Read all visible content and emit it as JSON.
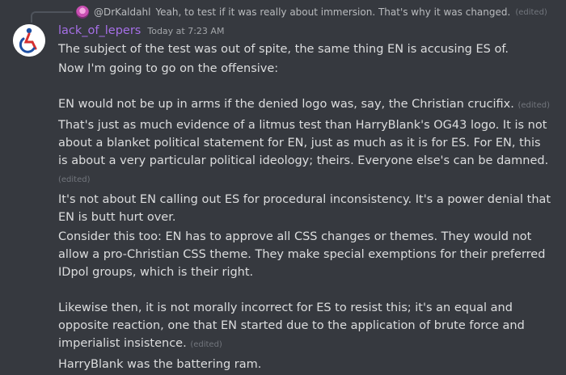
{
  "reply": {
    "author": "@DrKaldahl",
    "text": "Yeah, to test if it was really about immersion. That's why it was changed.",
    "edited": "(edited)"
  },
  "header": {
    "username": "lack_of_lepers",
    "timestamp": "Today at 7:23 AM"
  },
  "messages": [
    {
      "text": "The subject of the test was out of spite, the same thing EN is accusing ES of.",
      "edited": ""
    },
    {
      "text": "Now I'm going to go on the offensive:",
      "edited": ""
    },
    {
      "text": "EN would not be up in arms if the denied logo was, say, the Christian crucifix.",
      "edited": "(edited)"
    },
    {
      "text": "That's just as much evidence of a litmus test than HarryBlank's OG43 logo. It is not about a blanket political statement for EN, just as much as it is for ES. For EN, this is about a very particular political ideology; theirs. Everyone else's can be damned.",
      "edited": "(edited)"
    },
    {
      "text": "It's not about EN calling out ES for procedural inconsistency. It's a power denial that EN is butt hurt over.",
      "edited": ""
    },
    {
      "text": "Consider this too: EN has to approve all CSS changes or themes. They would not allow a pro-Christian CSS theme. They make special exemptions for their preferred IDpol groups, which is their right.",
      "edited": ""
    },
    {
      "text": "Likewise then, it is not morally incorrect for ES to resist this; it's an equal and opposite reaction, one that EN started due to the application of brute force and imperialist insistence.",
      "edited": "(edited)"
    },
    {
      "text": "HarryBlank was the battering ram.",
      "edited": ""
    }
  ],
  "colors": {
    "background": "#36393f",
    "username": "#a56fe6",
    "text": "#dcddde",
    "muted": "#72767d"
  }
}
